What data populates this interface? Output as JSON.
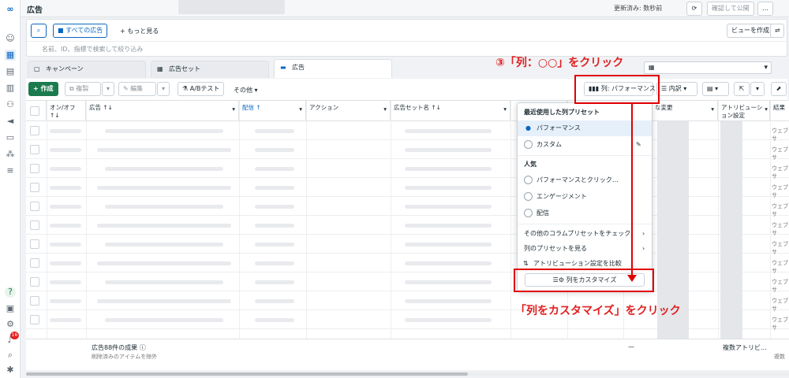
{
  "topbar": {
    "title": "広告",
    "status": "更新済み: 数秒前",
    "publish": "確認して公開",
    "more": "…"
  },
  "search": {
    "all_ads": "すべての広告",
    "more": "もっと見る",
    "placeholder": "名前、ID、指標で検索して絞り込み",
    "create_view": "ビューを作成"
  },
  "tabs": [
    {
      "label": "キャンペーン"
    },
    {
      "label": "広告セット"
    },
    {
      "label": "広告"
    }
  ],
  "toolbar": {
    "create": "作成",
    "duplicate": "複製",
    "edit": "編集",
    "ab_test": "A/Bテスト",
    "more": "その他",
    "columns": "列: パフォーマンス",
    "breakdown": "内訳"
  },
  "columns": [
    {
      "label": "オン/オフ\n↑↓"
    },
    {
      "label": "広告 ↑↓"
    },
    {
      "label": "配信 ↑"
    },
    {
      "label": "アクション"
    },
    {
      "label": "広告セット名 ↑↓"
    },
    {
      "label": "な変更"
    },
    {
      "label": "アトリビューション設定"
    },
    {
      "label": "結果"
    }
  ],
  "dropdown": {
    "recent_header": "最近使用した列プリセット",
    "performance": "パフォーマンス",
    "custom": "カスタム",
    "popular_header": "人気",
    "perf_click": "パフォーマンスとクリック…",
    "engagement": "エンゲージメント",
    "delivery": "配信",
    "check_presets": "その他のコラムプリセットをチェック",
    "view_presets": "列のプリセットを見る",
    "compare_attr": "アトリビューション設定を比較",
    "customize": "列をカスタマイズ"
  },
  "result_cell": "ウェブサ",
  "footer": {
    "summary": "広告88件の成果",
    "excluded": "削除済みのアイテムを除外",
    "dash": "—",
    "multi_attr": "複数アトリビ…",
    "multi": "複数"
  },
  "annotations": {
    "step3": "③「列：○○」をクリック",
    "customize_click": "「列をカスタマイズ」をクリック"
  },
  "badge": "16",
  "colors": {
    "accent": "#0a7cff",
    "primary_green": "#1b7b4f",
    "annotation_red": "#e00000"
  }
}
